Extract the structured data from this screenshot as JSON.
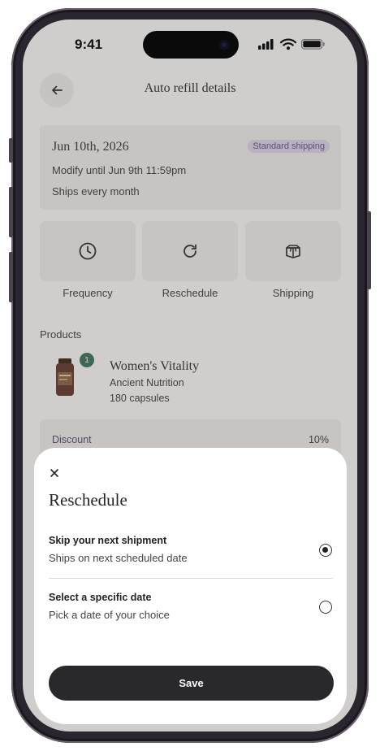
{
  "status_bar": {
    "time": "9:41"
  },
  "header": {
    "title": "Auto refill details"
  },
  "summary": {
    "date": "Jun 10th, 2026",
    "badge": "Standard shipping",
    "modify_until": "Modify until Jun 9th 11:59pm",
    "frequency": "Ships every month"
  },
  "actions": [
    {
      "label": "Frequency",
      "icon": "clock-icon"
    },
    {
      "label": "Reschedule",
      "icon": "refresh-icon"
    },
    {
      "label": "Shipping",
      "icon": "box-icon"
    }
  ],
  "products": {
    "section_label": "Products",
    "items": [
      {
        "count": "1",
        "name": "Women's Vitality",
        "brand": "Ancient Nutrition",
        "size": "180 capsules"
      }
    ]
  },
  "discount": {
    "label": "Discount",
    "value": "10%"
  },
  "sheet": {
    "title": "Reschedule",
    "options": [
      {
        "title": "Skip your next shipment",
        "subtitle": "Ships on next scheduled date",
        "selected": true
      },
      {
        "title": "Select a specific date",
        "subtitle": "Pick a date of your choice",
        "selected": false
      }
    ],
    "save_label": "Save"
  },
  "colors": {
    "badge_bg": "#ddd6ec",
    "badge_text": "#5b4a86",
    "count_badge": "#2f6e4e",
    "primary_button": "#29282b"
  }
}
